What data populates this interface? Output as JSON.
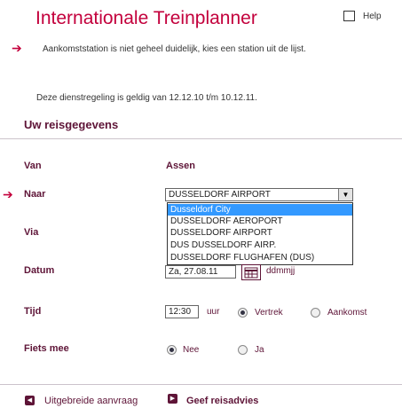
{
  "header": {
    "title": "Internationale Treinplanner",
    "help_label": "Help"
  },
  "notice": {
    "message": "Aankomststation is niet geheel duidelijk, kies een station uit de lijst."
  },
  "validity": {
    "text": "Deze dienstregeling is geldig van 12.12.10 t/m 10.12.11."
  },
  "form": {
    "section_title": "Uw reisgegevens",
    "van": {
      "label": "Van",
      "value": "Assen"
    },
    "naar": {
      "label": "Naar",
      "selected": "DUSSELDORF AIRPORT",
      "options": [
        "Dusseldorf City",
        "DUSSELDORF AEROPORT",
        "DUSSELDORF AIRPORT",
        "DUS DUSSELDORF AIRP.",
        "DUSSELDORF FLUGHAFEN (DUS)"
      ],
      "highlighted_index": 0
    },
    "via": {
      "label": "Via"
    },
    "datum": {
      "label": "Datum",
      "value": "Za, 27.08.11",
      "hint": "ddmmjj"
    },
    "tijd": {
      "label": "Tijd",
      "value": "12:30",
      "unit": "uur",
      "options": [
        "Vertrek",
        "Aankomst"
      ],
      "selected": "Vertrek"
    },
    "fiets": {
      "label": "Fiets mee",
      "options": [
        "Nee",
        "Ja"
      ],
      "selected": "Nee"
    }
  },
  "footer": {
    "back_label": "Uitgebreide aanvraag",
    "submit_label": "Geef reisadvies"
  },
  "colors": {
    "brand": "#c3003c",
    "label": "#5e1437",
    "highlight": "#3399ff"
  }
}
